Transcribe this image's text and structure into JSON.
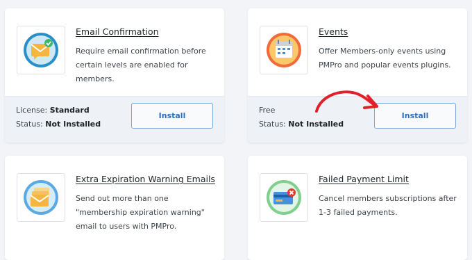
{
  "cards": [
    {
      "title": "Email Confirmation",
      "description": "Require email confirmation before certain levels are enabled for members.",
      "license_label": "License:",
      "license_value": "Standard",
      "status_label": "Status:",
      "status_value": "Not Installed",
      "button_label": "Install",
      "icon": "email-confirmation-icon"
    },
    {
      "title": "Events",
      "description": "Offer Members-only events using PMPro and popular events plugins.",
      "license_value": "Free",
      "status_label": "Status:",
      "status_value": "Not Installed",
      "button_label": "Install",
      "icon": "calendar-events-icon"
    },
    {
      "title": "Extra Expiration Warning Emails",
      "description": "Send out more than one \"membership expiration warning\" email to users with PMPro.",
      "icon": "stacked-emails-icon"
    },
    {
      "title": "Failed Payment Limit",
      "description": "Cancel members subscriptions after 1-3 failed payments.",
      "icon": "failed-payment-card-icon"
    }
  ],
  "colors": {
    "accent_red": "#e0202a",
    "button_blue": "#2f6fc0",
    "card_footer": "#eef1f6"
  }
}
